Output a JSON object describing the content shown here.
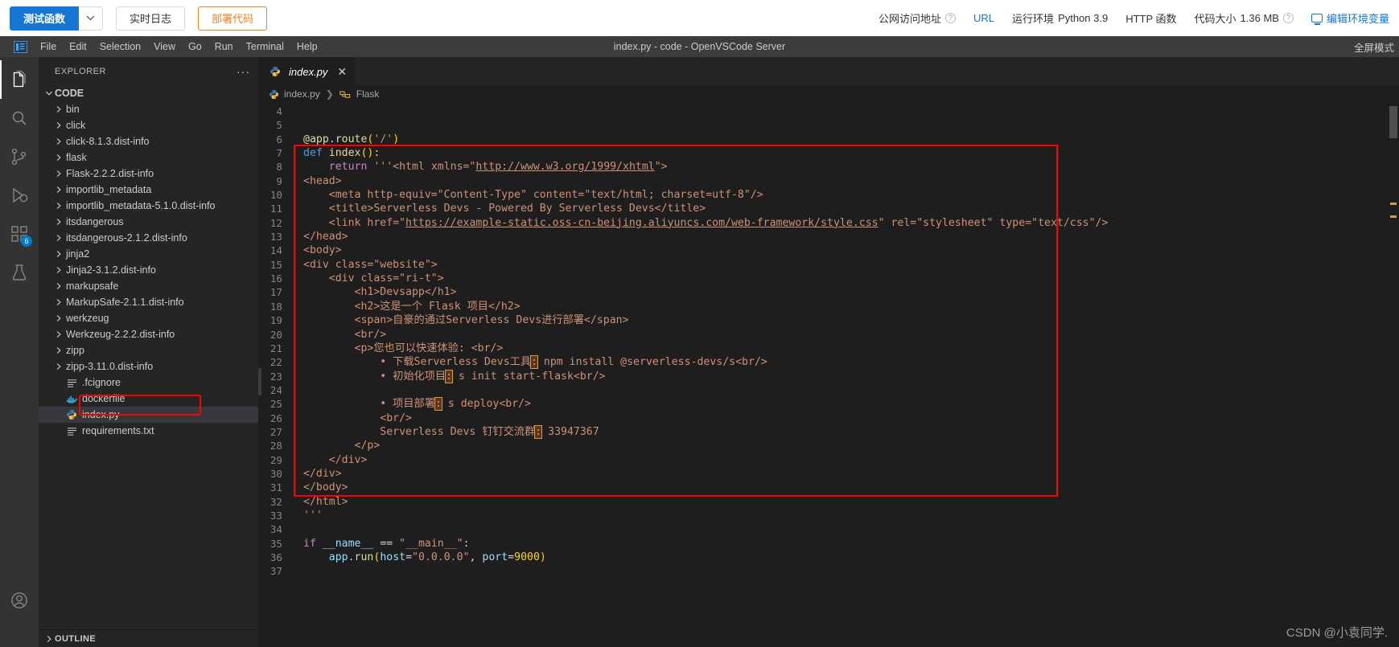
{
  "console": {
    "primary_button": "测试函数",
    "caret_icon": "chevron-down-icon",
    "realtime_log_button": "实时日志",
    "deploy_code_button": "部署代码",
    "public_url_label": "公网访问地址",
    "url_link": "URL",
    "runtime_label": "运行环境",
    "runtime_value": "Python 3.9",
    "http_function": "HTTP 函数",
    "code_size_label": "代码大小",
    "code_size_value": "1.36 MB",
    "edit_env_link": "编辑环境变量",
    "help_icon": "question-circle-icon",
    "monitor_icon": "monitor-icon"
  },
  "vscode": {
    "logo_icon": "vscode-logo-icon",
    "menu": [
      "File",
      "Edit",
      "Selection",
      "View",
      "Go",
      "Run",
      "Terminal",
      "Help"
    ],
    "window_title": "index.py - code - OpenVSCode Server",
    "fullscreen_label": "全屏模式",
    "activitybar": [
      {
        "name": "explorer",
        "icon": "files-icon",
        "active": true,
        "badge": ""
      },
      {
        "name": "search",
        "icon": "search-icon",
        "active": false,
        "badge": ""
      },
      {
        "name": "source-control",
        "icon": "source-control-icon",
        "active": false,
        "badge": ""
      },
      {
        "name": "run-and-debug",
        "icon": "run-debug-icon",
        "active": false,
        "badge": ""
      },
      {
        "name": "extensions",
        "icon": "extensions-icon",
        "active": false,
        "badge": "6"
      },
      {
        "name": "testing",
        "icon": "beaker-icon",
        "active": false,
        "badge": ""
      }
    ],
    "activitybar_bottom": [
      {
        "name": "accounts",
        "icon": "account-icon"
      }
    ],
    "sidebar": {
      "title": "EXPLORER",
      "more_actions": "···",
      "root": "CODE",
      "outline": "OUTLINE",
      "items": [
        {
          "label": "bin",
          "type": "folder",
          "icon": "chevron-right-icon"
        },
        {
          "label": "click",
          "type": "folder",
          "icon": "chevron-right-icon"
        },
        {
          "label": "click-8.1.3.dist-info",
          "type": "folder",
          "icon": "chevron-right-icon"
        },
        {
          "label": "flask",
          "type": "folder",
          "icon": "chevron-right-icon"
        },
        {
          "label": "Flask-2.2.2.dist-info",
          "type": "folder",
          "icon": "chevron-right-icon"
        },
        {
          "label": "importlib_metadata",
          "type": "folder",
          "icon": "chevron-right-icon"
        },
        {
          "label": "importlib_metadata-5.1.0.dist-info",
          "type": "folder",
          "icon": "chevron-right-icon"
        },
        {
          "label": "itsdangerous",
          "type": "folder",
          "icon": "chevron-right-icon"
        },
        {
          "label": "itsdangerous-2.1.2.dist-info",
          "type": "folder",
          "icon": "chevron-right-icon"
        },
        {
          "label": "jinja2",
          "type": "folder",
          "icon": "chevron-right-icon"
        },
        {
          "label": "Jinja2-3.1.2.dist-info",
          "type": "folder",
          "icon": "chevron-right-icon"
        },
        {
          "label": "markupsafe",
          "type": "folder",
          "icon": "chevron-right-icon"
        },
        {
          "label": "MarkupSafe-2.1.1.dist-info",
          "type": "folder",
          "icon": "chevron-right-icon"
        },
        {
          "label": "werkzeug",
          "type": "folder",
          "icon": "chevron-right-icon"
        },
        {
          "label": "Werkzeug-2.2.2.dist-info",
          "type": "folder",
          "icon": "chevron-right-icon"
        },
        {
          "label": "zipp",
          "type": "folder",
          "icon": "chevron-right-icon"
        },
        {
          "label": "zipp-3.11.0.dist-info",
          "type": "folder",
          "icon": "chevron-right-icon"
        },
        {
          "label": ".fcignore",
          "type": "file",
          "icon": "text-file-icon"
        },
        {
          "label": "dockerfile",
          "type": "file",
          "icon": "docker-icon"
        },
        {
          "label": "index.py",
          "type": "file",
          "icon": "python-icon",
          "selected": true
        },
        {
          "label": "requirements.txt",
          "type": "file",
          "icon": "text-file-icon"
        }
      ]
    },
    "editor": {
      "tab_label": "index.py",
      "tab_icon": "python-icon",
      "tab_close_icon": "close-icon",
      "breadcrumb": [
        {
          "label": "index.py",
          "icon": "python-icon"
        },
        {
          "label": "Flask",
          "icon": "symbol-class-icon"
        }
      ],
      "first_line_number": 4,
      "lines": [
        {
          "n": 4,
          "text": ""
        },
        {
          "n": 5,
          "text": ""
        },
        {
          "n": 6,
          "text": "@app.route('/')"
        },
        {
          "n": 7,
          "text": "def index():"
        },
        {
          "n": 8,
          "text": "    return '''<html xmlns=\"http://www.w3.org/1999/xhtml\">"
        },
        {
          "n": 9,
          "text": "<head>"
        },
        {
          "n": 10,
          "text": "    <meta http-equiv=\"Content-Type\" content=\"text/html; charset=utf-8\"/>"
        },
        {
          "n": 11,
          "text": "    <title>Serverless Devs - Powered By Serverless Devs</title>"
        },
        {
          "n": 12,
          "text": "    <link href=\"https://example-static.oss-cn-beijing.aliyuncs.com/web-framework/style.css\" rel=\"stylesheet\" type=\"text/css\"/>"
        },
        {
          "n": 13,
          "text": "</head>"
        },
        {
          "n": 14,
          "text": "<body>"
        },
        {
          "n": 15,
          "text": "<div class=\"website\">"
        },
        {
          "n": 16,
          "text": "    <div class=\"ri-t\">"
        },
        {
          "n": 17,
          "text": "        <h1>Devsapp</h1>"
        },
        {
          "n": 18,
          "text": "        <h2>这是一个 Flask 项目</h2>"
        },
        {
          "n": 19,
          "text": "        <span>自豪的通过Serverless Devs进行部署</span>"
        },
        {
          "n": 20,
          "text": "        <br/>"
        },
        {
          "n": 21,
          "text": "        <p>您也可以快速体验: <br/>"
        },
        {
          "n": 22,
          "text": "            • 下载Serverless Devs工具: npm install @serverless-devs/s<br/>"
        },
        {
          "n": 23,
          "text": "            • 初始化项目: s init start-flask<br/>"
        },
        {
          "n": 24,
          "text": ""
        },
        {
          "n": 25,
          "text": "            • 项目部署: s deploy<br/>"
        },
        {
          "n": 26,
          "text": "            <br/>"
        },
        {
          "n": 27,
          "text": "            Serverless Devs 钉钉交流群: 33947367"
        },
        {
          "n": 28,
          "text": "        </p>"
        },
        {
          "n": 29,
          "text": "    </div>"
        },
        {
          "n": 30,
          "text": "</div>"
        },
        {
          "n": 31,
          "text": "</body>"
        },
        {
          "n": 32,
          "text": "</html>"
        },
        {
          "n": 33,
          "text": "'''"
        },
        {
          "n": 34,
          "text": ""
        },
        {
          "n": 35,
          "text": "if __name__ == \"__main__\":"
        },
        {
          "n": 36,
          "text": "    app.run(host=\"0.0.0.0\", port=9000)"
        },
        {
          "n": 37,
          "text": ""
        }
      ]
    }
  },
  "annotations": {
    "highlight_color": "#ff0000",
    "file_highlight": "index.py",
    "code_block_highlight": "lines 8-33"
  },
  "watermark": "CSDN @小袁同学."
}
